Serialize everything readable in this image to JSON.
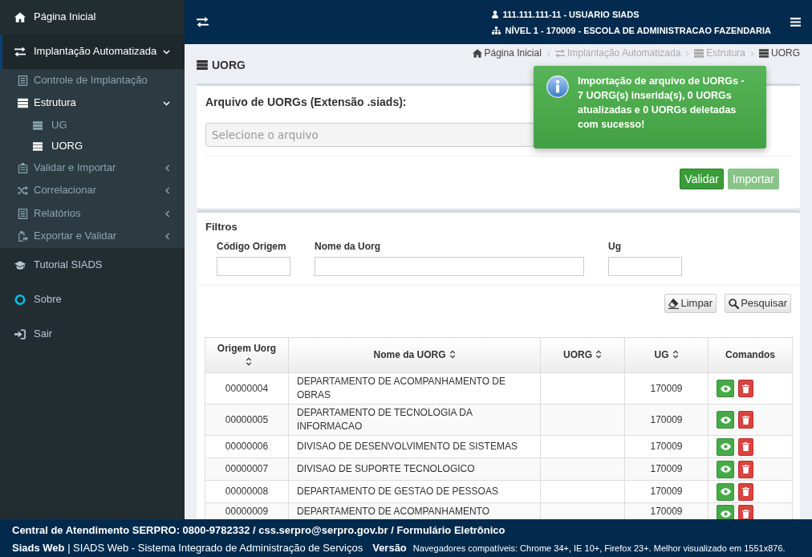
{
  "header": {
    "user": "111.111.111-11 - USUARIO SIADS",
    "unit": "NÍVEL 1 - 170009 - ESCOLA DE ADMINISTRACAO FAZENDARIA"
  },
  "sidebar": {
    "items": [
      {
        "label": "Página Inicial",
        "selected": false
      },
      {
        "label": "Implantação Automatizada",
        "selected": true,
        "expanded": true,
        "children": [
          {
            "label": "Controle de Implantação",
            "selected": false
          },
          {
            "label": "Estrutura",
            "selected": true,
            "expanded": true,
            "children": [
              {
                "label": "UG",
                "selected": false
              },
              {
                "label": "UORG",
                "selected": true
              }
            ]
          },
          {
            "label": "Validar e Importar",
            "selected": false,
            "expanded": false
          },
          {
            "label": "Correlacionar",
            "selected": false,
            "expanded": false
          },
          {
            "label": "Relatórios",
            "selected": false,
            "expanded": false
          },
          {
            "label": "Exportar e Validar",
            "selected": false,
            "expanded": false
          }
        ]
      },
      {
        "label": "Tutorial SIADS",
        "selected": false
      },
      {
        "label": "Sobre",
        "selected": false
      },
      {
        "label": "Sair",
        "selected": false
      }
    ]
  },
  "page_title": "UORG",
  "breadcrumb": [
    {
      "label": "Página Inicial",
      "disabled": false
    },
    {
      "label": "Implantação Automatizada",
      "disabled": true
    },
    {
      "label": "Estrutura",
      "disabled": true
    },
    {
      "label": "UORG",
      "disabled": false
    }
  ],
  "notification": {
    "message": "Importação de arquivo de UORGs - 7 UORG(s) inserida(s), 0 UORGs atualizadas e 0 UORGs deletadas com sucesso!"
  },
  "upload": {
    "label": "Arquivo de UORGs (Extensão .siads):",
    "file_field": {
      "placeholder": "Selecione o arquivo"
    },
    "buttons": [
      {
        "label": "Validar",
        "disabled": false
      },
      {
        "label": "Importar",
        "disabled": true
      }
    ]
  },
  "filters": {
    "title": "Filtros",
    "fields": [
      {
        "label": "Código Origem"
      },
      {
        "label": "Nome da Uorg"
      },
      {
        "label": "Ug"
      }
    ],
    "buttons": [
      {
        "label": "Limpar"
      },
      {
        "label": "Pesquisar"
      }
    ]
  },
  "table": {
    "columns": [
      {
        "label": "Origem Uorg",
        "sortable": true
      },
      {
        "label": "Nome da UORG",
        "sortable": true
      },
      {
        "label": "UORG",
        "sortable": true
      },
      {
        "label": "UG",
        "sortable": true
      },
      {
        "label": "Comandos",
        "sortable": false
      }
    ],
    "rows": [
      {
        "origem_uorg": "00000004",
        "nome_da_uorg": "DEPARTAMENTO DE ACOMPANHAMENTO DE OBRAS",
        "ug": "170009"
      },
      {
        "origem_uorg": "00000005",
        "nome_da_uorg": "DEPARTAMENTO DE TECNOLOGIA DA INFORMACAO",
        "ug": "170009"
      },
      {
        "origem_uorg": "00000006",
        "nome_da_uorg": "DIVISAO DE DESENVOLVIMENTO DE SISTEMAS",
        "ug": "170009"
      },
      {
        "origem_uorg": "00000007",
        "nome_da_uorg": "DIVISAO DE SUPORTE TECNOLOGICO",
        "ug": "170009"
      },
      {
        "origem_uorg": "00000008",
        "nome_da_uorg": "DEPARTAMENTO DE GESTAO DE PESSOAS",
        "ug": "170009"
      },
      {
        "origem_uorg": "00000009",
        "nome_da_uorg": "DEPARTAMENTO DE ACOMPANHAMENTO",
        "ug": "170009"
      }
    ]
  },
  "footer": {
    "contact": "Central de Atendimento SERPRO: 0800-9782332 / css.serpro@serpro.gov.br / Formulário Eletrônico",
    "app": "**Siads Web** | SIADS Web - Sistema Integrado de Administração de Serviços",
    "version_label": "Versão",
    "browsers": "Navegadores compatíveis: Chrome 34+, IE 10+, Firefox 23+. Melhor visualizado em 1551x876."
  }
}
